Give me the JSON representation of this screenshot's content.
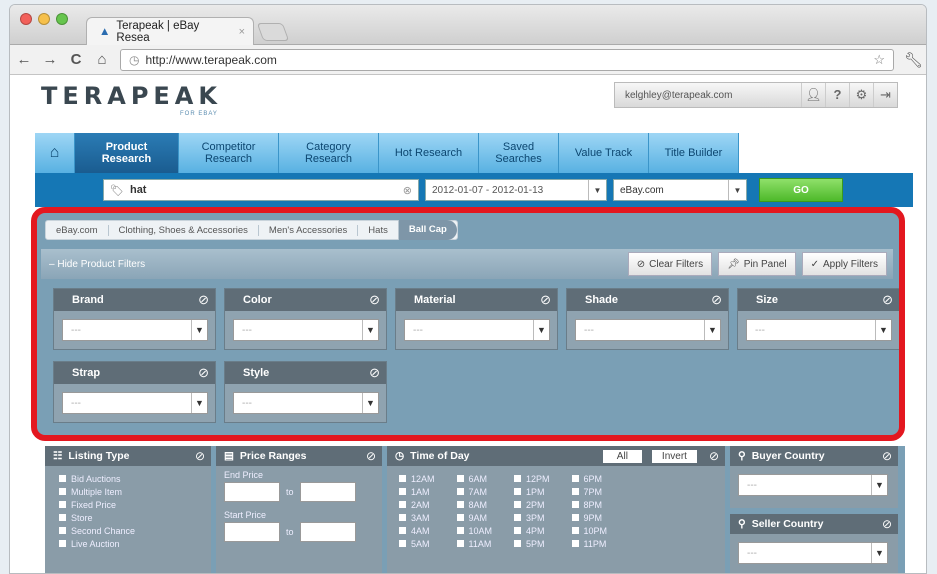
{
  "browser": {
    "tab_title": "Terapeak | eBay Resea",
    "url": "http://www.terapeak.com"
  },
  "header": {
    "logo": "TERAPEAK",
    "logo_sub": "FOR EBAY",
    "account_email": "kelghley@terapeak.com"
  },
  "nav_tabs": [
    {
      "label": "Product Research",
      "active": true
    },
    {
      "label": "Competitor Research"
    },
    {
      "label": "Category Research"
    },
    {
      "label": "Hot Research"
    },
    {
      "label": "Saved Searches"
    },
    {
      "label": "Value Track"
    },
    {
      "label": "Title Builder"
    }
  ],
  "search": {
    "query": "hat",
    "date_range": "2012-01-07 - 2012-01-13",
    "site": "eBay.com",
    "go_label": "GO"
  },
  "breadcrumb": [
    "eBay.com",
    "Clothing, Shoes & Accessories",
    "Men's Accessories",
    "Hats",
    "Ball Cap"
  ],
  "filter_bar": {
    "hide_label": "Hide Product Filters",
    "clear_label": "Clear Filters",
    "pin_label": "Pin Panel",
    "apply_label": "Apply Filters"
  },
  "filters": [
    {
      "label": "Brand",
      "value": "---"
    },
    {
      "label": "Color",
      "value": "---"
    },
    {
      "label": "Material",
      "value": "---"
    },
    {
      "label": "Shade",
      "value": "---"
    },
    {
      "label": "Size",
      "value": "---"
    },
    {
      "label": "Strap",
      "value": "---"
    },
    {
      "label": "Style",
      "value": "---"
    }
  ],
  "lower": {
    "listing_type": {
      "title": "Listing Type",
      "items": [
        "Bid Auctions",
        "Multiple Item",
        "Fixed Price",
        "Store",
        "Second Chance",
        "Live Auction"
      ]
    },
    "price_ranges": {
      "title": "Price Ranges",
      "end_label": "End Price",
      "start_label": "Start Price",
      "to": "to"
    },
    "time_of_day": {
      "title": "Time of Day",
      "all": "All",
      "invert": "Invert",
      "col1": [
        "12AM",
        "1AM",
        "2AM",
        "3AM",
        "4AM",
        "5AM"
      ],
      "col2": [
        "6AM",
        "7AM",
        "8AM",
        "9AM",
        "10AM",
        "11AM"
      ],
      "col3": [
        "12PM",
        "1PM",
        "2PM",
        "3PM",
        "4PM",
        "5PM"
      ],
      "col4": [
        "6PM",
        "7PM",
        "8PM",
        "9PM",
        "10PM",
        "11PM"
      ]
    },
    "buyer_country": {
      "title": "Buyer Country",
      "value": "---"
    },
    "seller_country": {
      "title": "Seller Country",
      "value": "---"
    }
  }
}
